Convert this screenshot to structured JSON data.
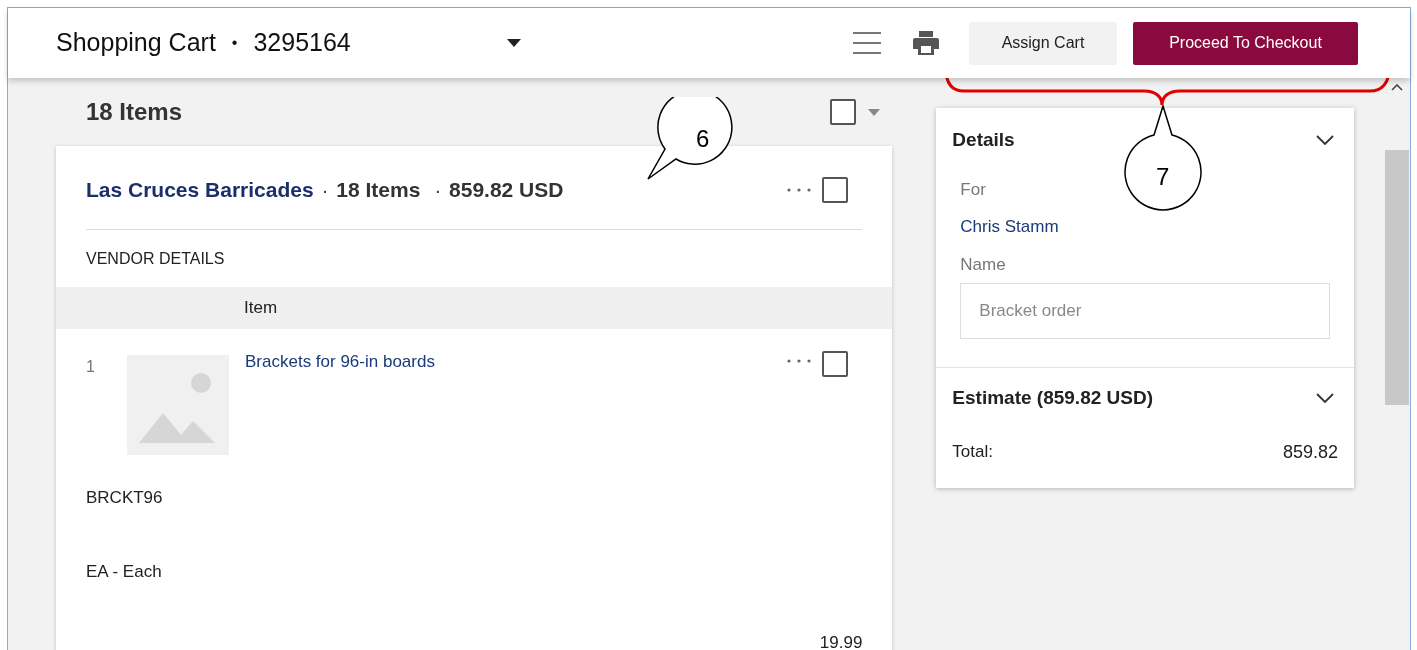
{
  "header": {
    "title": "Shopping Cart",
    "separator": "•",
    "cart_number": "3295164",
    "buttons": [
      {
        "label": "Assign Cart",
        "kind": "secondary"
      },
      {
        "label": "Proceed To Checkout",
        "kind": "primary"
      }
    ]
  },
  "items_summary": {
    "count": "18 Items",
    "checked": false
  },
  "vendor_group": {
    "vendor": "Las Cruces Barricades",
    "separator": "·",
    "item_count": "18 Items",
    "total": "859.82 USD",
    "checked": false,
    "section_label": "VENDOR DETAILS",
    "column_header": "Item",
    "items": [
      {
        "index": "1",
        "name": "Brackets for 96-in boards",
        "checked": false,
        "part_number": "BRCKT96",
        "unit": "EA - Each",
        "price": "19.99"
      }
    ]
  },
  "details": {
    "title": "Details",
    "for_label": "For",
    "for_value": "Chris Stamm",
    "name_label": "Name",
    "name_placeholder": "Bracket order"
  },
  "estimate": {
    "title": "Estimate (859.82 USD)",
    "total_label": "Total:",
    "total_value": "859.82"
  },
  "callouts": [
    {
      "number": "6"
    },
    {
      "number": "7"
    }
  ]
}
